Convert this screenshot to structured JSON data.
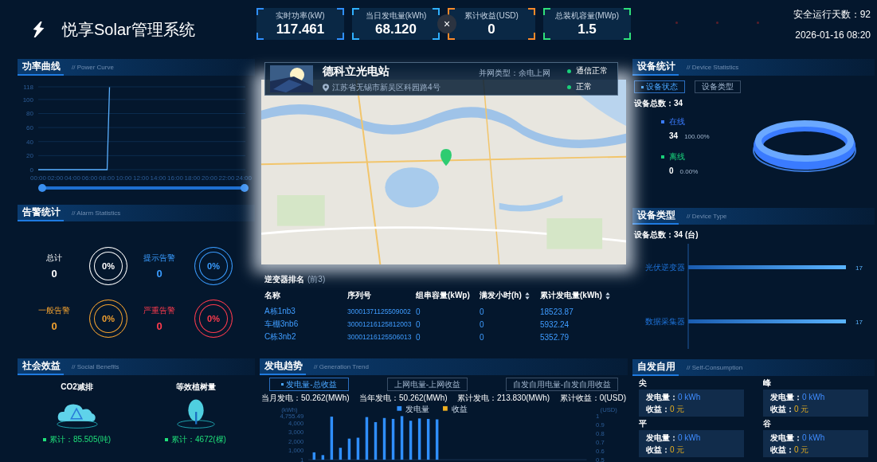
{
  "header": {
    "title": "悦享Solar管理系统",
    "kpis": [
      {
        "label": "实时功率(kW)",
        "value": "117.461",
        "color": "#2f8fff"
      },
      {
        "label": "当日发电量(kWh)",
        "value": "68.120",
        "color": "#2fb0ff"
      },
      {
        "label": "累计收益(USD)",
        "value": "0",
        "color": "#ff8a2a"
      },
      {
        "label": "总装机容量(MWp)",
        "value": "1.5",
        "color": "#2fe07a"
      }
    ],
    "close_button": "×",
    "safe_days": "安全运行天数：92",
    "datetime": "2026-01-16 08:20"
  },
  "power_curve": {
    "title": "功率曲线",
    "subtitle": "// Power Curve",
    "zoom_slider": {
      "level": 1
    },
    "chart_data": {
      "type": "line",
      "grid": true,
      "x": [
        0,
        8.05,
        8.33
      ],
      "series": [
        {
          "color": "#5ab0ff",
          "values": [
            0,
            0,
            117.461
          ]
        }
      ],
      "xlim": [
        0,
        24
      ],
      "ylim": [
        0,
        118
      ],
      "yticks": [
        0,
        20,
        40,
        60,
        80,
        100,
        118
      ],
      "xticks": [
        {
          "value": 0,
          "label": "00:00"
        },
        {
          "value": 2,
          "label": "02:00"
        },
        {
          "value": 4,
          "label": "04:00"
        },
        {
          "value": 6,
          "label": "06:00"
        },
        {
          "value": 8,
          "label": "08:00"
        },
        {
          "value": 10,
          "label": "10:00"
        },
        {
          "value": 12,
          "label": "12:00"
        },
        {
          "value": 14,
          "label": "14:00"
        },
        {
          "value": 16,
          "label": "16:00"
        },
        {
          "value": 18,
          "label": "18:00"
        },
        {
          "value": 20,
          "label": "20:00"
        },
        {
          "value": 22,
          "label": "22:00"
        },
        {
          "value": 24,
          "label": "24:00"
        }
      ]
    }
  },
  "alarm_statistics": {
    "title": "告警统计",
    "subtitle": "// Alarm Statistics",
    "items": [
      {
        "label": "总计",
        "value": "0",
        "percent": "0%",
        "color": "#ffffff"
      },
      {
        "label": "提示告警",
        "value": "0",
        "percent": "0%",
        "color": "#3a9cff"
      },
      {
        "label": "一般告警",
        "value": "0",
        "percent": "0%",
        "color": "#f0a030"
      },
      {
        "label": "严重告警",
        "value": "0",
        "percent": "0%",
        "color": "#ff3b4e"
      }
    ]
  },
  "social_benefits": {
    "title": "社会效益",
    "subtitle": "// Social Benefits",
    "items": [
      {
        "kind": "cloud",
        "label": "CO2减排",
        "total": "累计：85.505(吨)"
      },
      {
        "kind": "tree",
        "label": "等效植树量",
        "total": "累计：4672(棵)"
      }
    ]
  },
  "station": {
    "name": "德科立光电站",
    "grid_type": "并网类型：余电上网",
    "address": "江苏省无锡市新吴区科园路4号",
    "statuses": [
      {
        "label": "通信正常",
        "color": "#19d07a"
      },
      {
        "label": "正常",
        "color": "#19d07a"
      }
    ]
  },
  "inverter_ranking": {
    "title": "逆变器排名",
    "note": "(前3)",
    "columns": [
      {
        "label": "名称",
        "sortable": false
      },
      {
        "label": "序列号",
        "sortable": false
      },
      {
        "label": "组串容量(kWp)",
        "sortable": false
      },
      {
        "label": "满发小时(h)",
        "sortable": true
      },
      {
        "label": "累计发电量(kWh)",
        "sortable": true
      }
    ],
    "rows": [
      [
        "A栋1nb3",
        "30001371125509002",
        "0",
        "0",
        "18523.87"
      ],
      [
        "车棚3nb6",
        "30001216125812003",
        "0",
        "0",
        "5932.24"
      ],
      [
        "C栋3nb2",
        "30001216125506013",
        "0",
        "0",
        "5352.79"
      ]
    ]
  },
  "generation_trend": {
    "title": "发电趋势",
    "subtitle": "// Generation Trend",
    "tabs": [
      {
        "label": "发电量-总收益",
        "selected": true
      },
      {
        "label": "上网电量-上网收益",
        "selected": false
      },
      {
        "label": "自发自用电量-自发自用收益",
        "selected": false
      }
    ],
    "stats": [
      "当月发电：50.262(MWh)",
      "当年发电：50.262(MWh)",
      "累计发电：213.830(MWh)",
      "累计收益：0(USD)"
    ],
    "legend": [
      {
        "label": "发电量",
        "color": "#2f8fff"
      },
      {
        "label": "收益",
        "color": "#f0b020"
      }
    ],
    "right_axis": {
      "label": "(USD)",
      "ticks": [
        "1",
        "0.9",
        "0.8",
        "0.7",
        "0.6",
        "0.5"
      ]
    },
    "chart_data": {
      "type": "bar",
      "ylabel": "(kWh)",
      "series": [
        {
          "color": "#2f8fff",
          "values": [
            800,
            500,
            4700,
            1300,
            2300,
            2400,
            4650,
            4100,
            4550,
            4450,
            4755.49,
            4250,
            4500,
            4450,
            4400
          ]
        }
      ],
      "ylim": [
        0,
        4755.49
      ],
      "yticks": [
        {
          "value": 1,
          "label": "1"
        },
        {
          "value": 1000,
          "label": "1,000"
        },
        {
          "value": 2000,
          "label": "2,000"
        },
        {
          "value": 3000,
          "label": "3,000"
        },
        {
          "value": 4000,
          "label": "4,000"
        },
        {
          "value": 4755.49,
          "label": "4,755.49"
        }
      ]
    }
  },
  "device_statistics": {
    "title": "设备统计",
    "subtitle": "// Device Statistics",
    "tabs": [
      {
        "label": "设备状态",
        "selected": true
      },
      {
        "label": "设备类型",
        "selected": false
      }
    ],
    "total": "设备总数：34",
    "items": [
      {
        "label": "在线",
        "count": "34",
        "percent": "100.00%",
        "color": "#3a7bff"
      },
      {
        "label": "离线",
        "count": "0",
        "percent": "0.00%",
        "color": "#19d07a"
      }
    ]
  },
  "device_type": {
    "title": "设备类型",
    "subtitle": "// Device Type",
    "total": "设备总数：34 (台)",
    "chart_data": {
      "type": "bar",
      "orientation": "horizontal",
      "categories": [
        "光伏逆变器",
        "数据采集器"
      ],
      "values": [
        17,
        17
      ],
      "data_labels": true
    }
  },
  "self_consumption": {
    "title": "自发自用",
    "subtitle": "// Self-Consumption",
    "periods": [
      {
        "label": "尖",
        "generation_label": "发电量：",
        "generation": "0 kWh",
        "revenue_label": "收益：",
        "revenue": "0 元"
      },
      {
        "label": "峰",
        "generation_label": "发电量：",
        "generation": "0 kWh",
        "revenue_label": "收益：",
        "revenue": "0 元"
      },
      {
        "label": "平",
        "generation_label": "发电量：",
        "generation": "0 kWh",
        "revenue_label": "收益：",
        "revenue": "0 元"
      },
      {
        "label": "谷",
        "generation_label": "发电量：",
        "generation": "0 kWh",
        "revenue_label": "收益：",
        "revenue": "0 元"
      }
    ]
  }
}
